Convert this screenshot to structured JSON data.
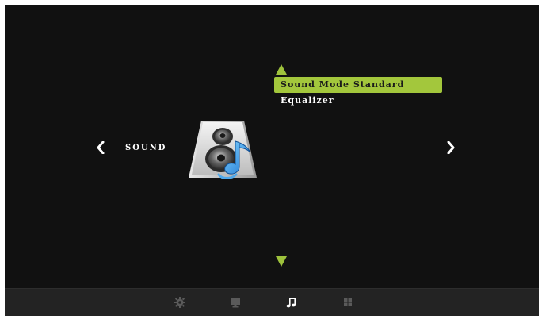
{
  "menu": {
    "items": [
      {
        "label": "Sound Mode Standard",
        "selected": true
      },
      {
        "label": "Equalizer",
        "selected": false
      }
    ]
  },
  "section": {
    "label": "SOUND",
    "icon": "speaker-music-icon"
  },
  "navigation": {
    "up_icon": "triangle-up-icon",
    "down_icon": "triangle-down-icon",
    "prev_icon": "chevron-left-icon",
    "next_icon": "chevron-right-icon"
  },
  "bottom_tabs": [
    {
      "icon": "gear-icon",
      "active": false
    },
    {
      "icon": "monitor-icon",
      "active": false
    },
    {
      "icon": "music-note-icon",
      "active": true
    },
    {
      "icon": "grid-icon",
      "active": false
    }
  ],
  "colors": {
    "accent": "#a3c73c",
    "background": "#111111",
    "bar": "#232323",
    "inactive_icon": "#5a5a5a",
    "active_icon": "#ffffff"
  }
}
